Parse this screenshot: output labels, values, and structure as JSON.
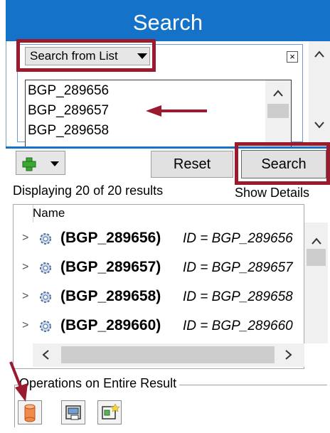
{
  "header": {
    "title": "Search"
  },
  "criteria": {
    "mode_dropdown": "Search from List",
    "close_glyph": "×",
    "list_items": [
      "BGP_289656",
      "BGP_289657",
      "BGP_289658"
    ]
  },
  "toolbar": {
    "add_icon": "green-plus-icon",
    "reset_label": "Reset",
    "search_label": "Search"
  },
  "results": {
    "summary": "Displaying 20 of 20 results",
    "show_details": "Show Details",
    "column_name": "Name",
    "rows": [
      {
        "name": "(BGP_289656)",
        "id": "ID = BGP_289656"
      },
      {
        "name": "(BGP_289657)",
        "id": "ID = BGP_289657"
      },
      {
        "name": "(BGP_289658)",
        "id": "ID = BGP_289658"
      },
      {
        "name": "(BGP_289660)",
        "id": "ID = BGP_289660"
      }
    ]
  },
  "operations": {
    "label": "Operations on Entire Result",
    "buttons": [
      "database-icon",
      "export-icon",
      "new-window-icon"
    ]
  },
  "colors": {
    "header_blue": "#1572c9",
    "highlight_red": "#9a1b2d"
  }
}
